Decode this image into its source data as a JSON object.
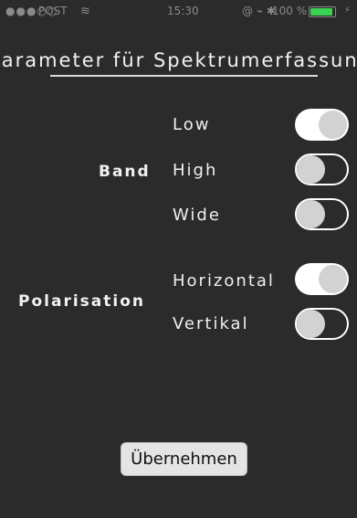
{
  "status_bar": {
    "signal_dots": "●●●○○",
    "carrier": "POST",
    "wifi_icon": "wifi-icon",
    "time": "15:30",
    "system_icons": "@ ⌁ ✱",
    "battery_percent": "100 %",
    "battery_level": 1.0,
    "battery_color": "#39d353"
  },
  "title": "Parameter für Spektrumerfassung",
  "band": {
    "label": "Band",
    "options": [
      {
        "label": "Low",
        "on": true
      },
      {
        "label": "High",
        "on": false
      },
      {
        "label": "Wide",
        "on": false
      }
    ]
  },
  "polarisation": {
    "label": "Polarisation",
    "options": [
      {
        "label": "Horizontal",
        "on": true
      },
      {
        "label": "Vertikal",
        "on": false
      }
    ]
  },
  "apply_button": "Übernehmen"
}
